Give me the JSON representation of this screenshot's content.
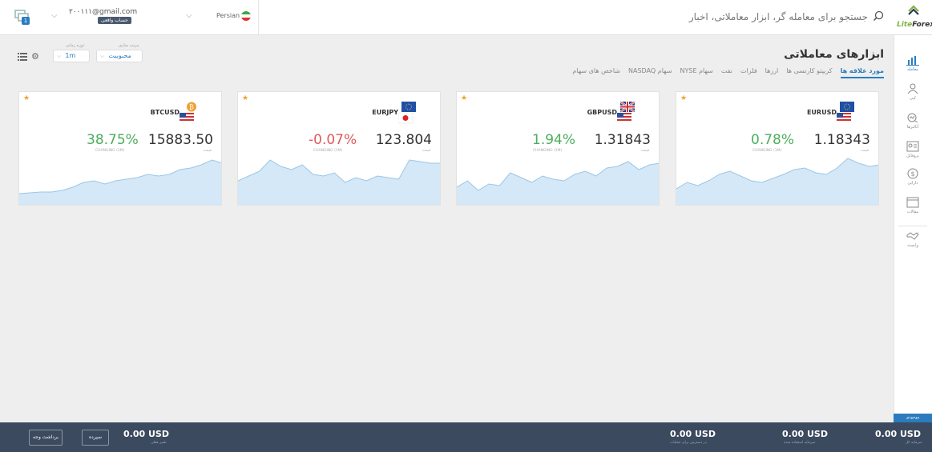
{
  "topbar": {
    "notification_count": "1",
    "account_email": "۲۰۰۱۱۱@gmail.com",
    "account_type": "حساب واقعی",
    "language": "Persian",
    "search_placeholder": "جستجو برای معامله گر، ابزار معاملاتی، اخبار",
    "logo_text_a": "Lite",
    "logo_text_b": "Forex"
  },
  "sidebar": {
    "items": [
      {
        "label": "معامله",
        "icon": "chart-icon"
      },
      {
        "label": "کپی",
        "icon": "people-icon"
      },
      {
        "label": "آنالیزها",
        "icon": "analysis-icon"
      },
      {
        "label": "پروفایل",
        "icon": "profile-icon"
      },
      {
        "label": "دارایی",
        "icon": "dollar-icon"
      },
      {
        "label": "مقالات",
        "icon": "window-icon"
      },
      {
        "label": "وابسته",
        "icon": "handshake-icon"
      }
    ],
    "bottom_label": "موجودی"
  },
  "filters": {
    "sort_label": "مرتب سازی",
    "sort_value": "محبوبیت",
    "period_label": "دوره زمانی",
    "period_value": "1m"
  },
  "main": {
    "title": "ابزارهای معاملاتی",
    "tabs": [
      "مورد علاقه ها",
      "کریپتو کارنسی ها",
      "ارزها",
      "فلزات",
      "نفت",
      "سهام NYSE",
      "سهام NASDAQ",
      "شاخص های سهام"
    ]
  },
  "cards": [
    {
      "symbol": "EURUSD",
      "change": "0.78%",
      "change_label": "CHANGING (1M)",
      "price": "1.18343",
      "price_label": "قیمت",
      "trend": "up",
      "spark": [
        20,
        28,
        24,
        30,
        38,
        42,
        36,
        30,
        28,
        33,
        38,
        44,
        46,
        40,
        38,
        46,
        58,
        52,
        48,
        50
      ]
    },
    {
      "symbol": "GBPUSD",
      "change": "1.94%",
      "change_label": "CHANGING (1M)",
      "price": "1.31843",
      "price_label": "قیمت",
      "trend": "up",
      "spark": [
        22,
        30,
        18,
        26,
        24,
        40,
        34,
        28,
        36,
        32,
        30,
        38,
        42,
        36,
        46,
        48,
        54,
        44,
        50,
        52
      ]
    },
    {
      "symbol": "EURJPY",
      "change": "-0.07%",
      "change_label": "CHANGING (1M)",
      "price": "123.804",
      "price_label": "قیمت",
      "trend": "down",
      "spark": [
        30,
        36,
        42,
        56,
        48,
        44,
        50,
        38,
        36,
        40,
        28,
        34,
        30,
        36,
        34,
        32,
        56,
        54,
        52,
        52
      ]
    },
    {
      "symbol": "BTCUSD",
      "change": "38.75%",
      "change_label": "CHANGING (1M)",
      "price": "15883.50",
      "price_label": "قیمت",
      "trend": "up",
      "spark": [
        14,
        15,
        16,
        16,
        18,
        22,
        28,
        30,
        26,
        30,
        32,
        34,
        38,
        36,
        38,
        44,
        46,
        50,
        56,
        52
      ]
    }
  ],
  "footer": {
    "withdraw_label": "برداشت وجه",
    "deposit_label": "سپرده",
    "left_value": "0.00 USD",
    "left_label": "تغییر فعلی",
    "v1": "0.00 USD",
    "v1_label": "در دسترس برای عملیات",
    "v2": "0.00 USD",
    "v2_label": "سرمایه استفاده شده",
    "v3": "0.00 USD",
    "v3_label": "سرمایه کل"
  }
}
